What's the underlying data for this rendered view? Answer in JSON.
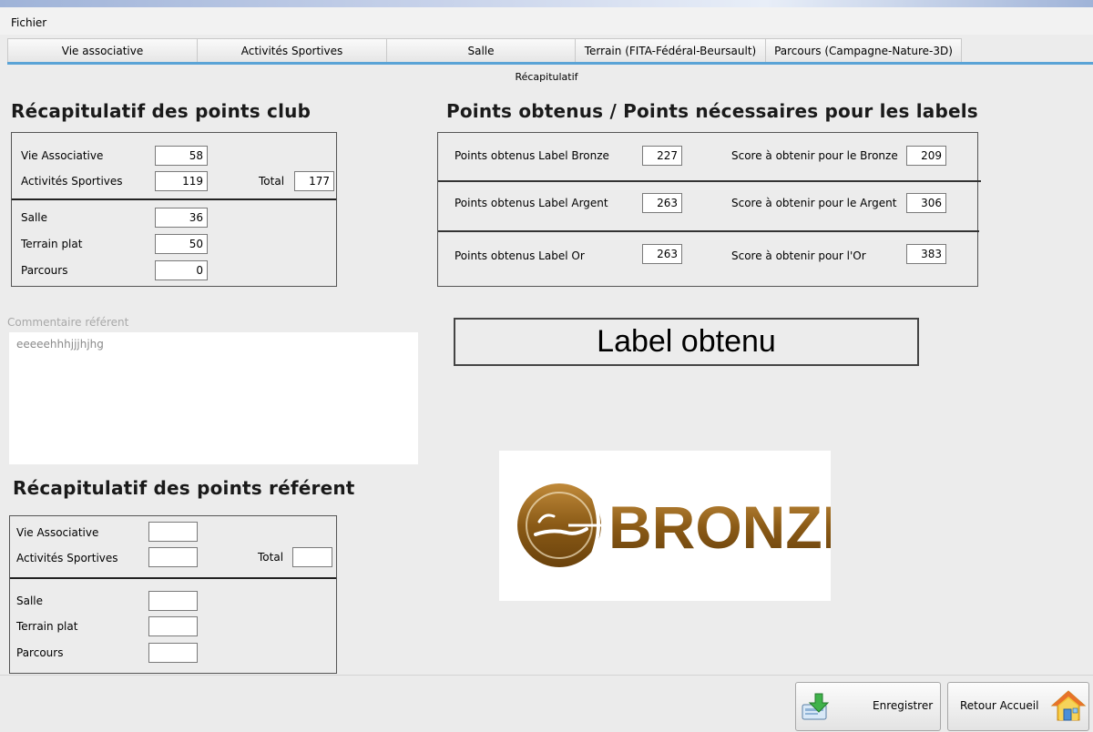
{
  "menubar": {
    "file": "Fichier"
  },
  "tabs": [
    {
      "label": "Vie associative"
    },
    {
      "label": "Activités Sportives"
    },
    {
      "label": "Salle"
    },
    {
      "label": "Terrain (FITA-Fédéral-Beursault)"
    },
    {
      "label": "Parcours (Campagne-Nature-3D)"
    }
  ],
  "subtab": "Récapitulatif",
  "club": {
    "title": "Récapitulatif des points club",
    "vie_associative": {
      "label": "Vie Associative",
      "value": "58"
    },
    "activites_sportives": {
      "label": "Activités Sportives",
      "value": "119"
    },
    "total": {
      "label": "Total",
      "value": "177"
    },
    "salle": {
      "label": "Salle",
      "value": "36"
    },
    "terrain_plat": {
      "label": "Terrain plat",
      "value": "50"
    },
    "parcours": {
      "label": "Parcours",
      "value": "0"
    }
  },
  "labels_points": {
    "title": "Points obtenus / Points nécessaires pour les labels",
    "rows": [
      {
        "obtained_label": "Points obtenus Label Bronze",
        "obtained": "227",
        "needed_label": "Score à obtenir pour le Bronze",
        "needed": "209"
      },
      {
        "obtained_label": "Points obtenus Label Argent",
        "obtained": "263",
        "needed_label": "Score à obtenir pour le Argent",
        "needed": "306"
      },
      {
        "obtained_label": "Points obtenus Label Or",
        "obtained": "263",
        "needed_label": "Score à obtenir pour l'Or",
        "needed": "383"
      }
    ]
  },
  "comment": {
    "label": "Commentaire référent",
    "text": "eeeeehhhjjjhjhg"
  },
  "label_obtenu": "Label obtenu",
  "logo": {
    "text": "BRONZE",
    "color": "#8a5a16"
  },
  "referent": {
    "title": "Récapitulatif des points référent",
    "vie_associative": {
      "label": "Vie Associative",
      "value": ""
    },
    "activites_sportives": {
      "label": "Activités Sportives",
      "value": ""
    },
    "total": {
      "label": "Total",
      "value": ""
    },
    "salle": {
      "label": "Salle",
      "value": ""
    },
    "terrain_plat": {
      "label": "Terrain plat",
      "value": ""
    },
    "parcours": {
      "label": "Parcours",
      "value": ""
    }
  },
  "buttons": {
    "save": "Enregistrer",
    "home": "Retour Accueil",
    "save_icon": "save-download-icon",
    "home_icon": "house-icon"
  }
}
